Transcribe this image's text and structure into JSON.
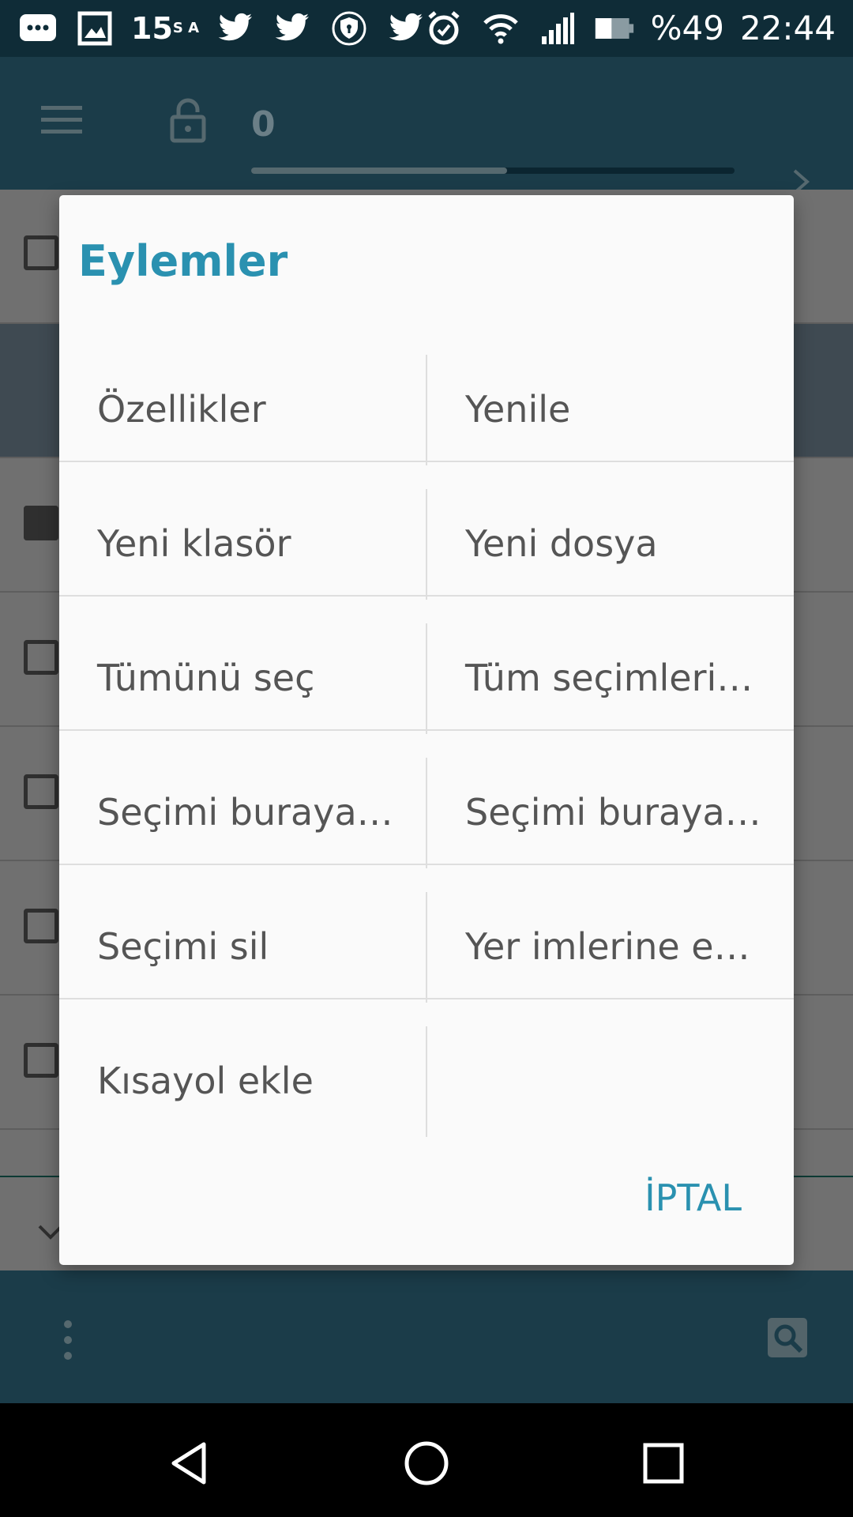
{
  "status_bar": {
    "left_icons": [
      "message-icon",
      "image-icon",
      "weather-icon",
      "twitter-icon",
      "twitter-icon",
      "vpn-shield-icon",
      "twitter-icon"
    ],
    "temperature": "15",
    "temp_unit": "S A",
    "battery": "%49",
    "time": "22:44",
    "right_icons": [
      "alarm-icon",
      "wifi-icon",
      "signal-icon",
      "battery-icon"
    ]
  },
  "toolbar": {
    "tab_label": "0",
    "progress": 0.53
  },
  "dialog": {
    "title": "Eylemler",
    "items": [
      {
        "label": "Özellikler"
      },
      {
        "label": "Yenile"
      },
      {
        "label": "Yeni klasör"
      },
      {
        "label": "Yeni dosya"
      },
      {
        "label": "Tümünü seç"
      },
      {
        "label": "Tüm seçimleri…"
      },
      {
        "label": "Seçimi buraya…"
      },
      {
        "label": "Seçimi buraya…"
      },
      {
        "label": "Seçimi sil"
      },
      {
        "label": "Yer imlerine e…"
      },
      {
        "label": "Kısayol ekle"
      },
      {
        "label": ""
      }
    ],
    "cancel_label": "İPTAL"
  },
  "colors": {
    "accent": "#2a91b0",
    "toolbar_bg": "#1b3c49",
    "status_bg": "#0f2c37"
  }
}
